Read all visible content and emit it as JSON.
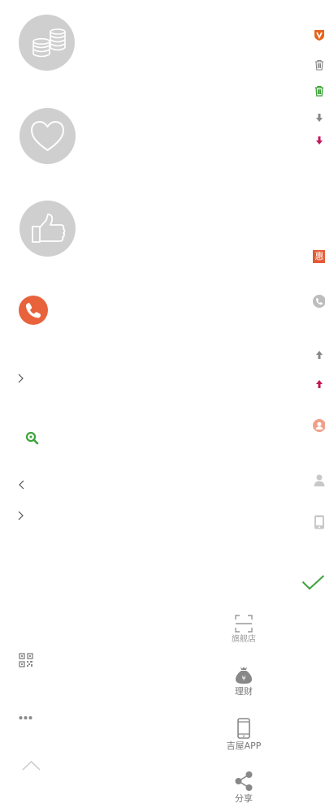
{
  "side_tools": {
    "flagship_store_label": "旗舰店",
    "finance_label": "理财",
    "app_label": "吉屋APP",
    "share_label": "分享"
  },
  "badge": {
    "hui_text": "惠"
  },
  "colors": {
    "circle_gray": "#cfcfcf",
    "phone_orange": "#e8623c",
    "accent_green": "#3ea23a",
    "accent_red": "#c2185b",
    "badge_red": "#e35a34"
  },
  "icons": [
    "coins-icon",
    "heart-icon",
    "thumbs-up-icon",
    "phone-icon",
    "chevron-right-icon",
    "search-icon",
    "chevron-left-icon",
    "qr-code-icon",
    "more-icon",
    "chevron-up-icon",
    "vip-badge-icon",
    "trash-icon",
    "trash-green-icon",
    "arrow-down-icon",
    "arrow-down-red-icon",
    "phone-gray-icon",
    "arrow-up-icon",
    "arrow-up-red-icon",
    "user-orange-icon",
    "user-gray-icon",
    "mobile-gray-icon",
    "check-icon",
    "scan-icon",
    "money-bag-icon",
    "mobile-icon",
    "share-icon"
  ]
}
